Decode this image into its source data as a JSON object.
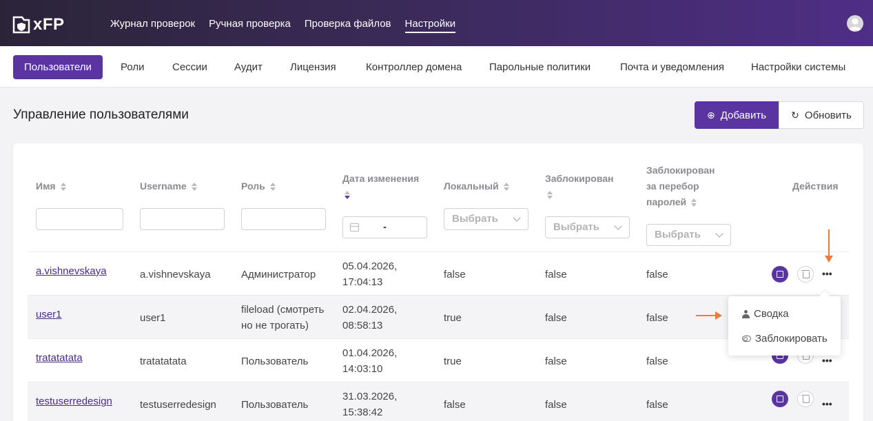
{
  "app": {
    "logo_text": "xFP"
  },
  "topnav": [
    {
      "label": "Журнал проверок"
    },
    {
      "label": "Ручная проверка"
    },
    {
      "label": "Проверка файлов"
    },
    {
      "label": "Настройки"
    }
  ],
  "subnav": [
    {
      "label": "Пользователи"
    },
    {
      "label": "Роли"
    },
    {
      "label": "Сессии"
    },
    {
      "label": "Аудит"
    },
    {
      "label": "Лицензия"
    },
    {
      "label": "Контроллер домена"
    },
    {
      "label": "Парольные политики"
    },
    {
      "label": "Почта и уведомления"
    },
    {
      "label": "Настройки системы"
    }
  ],
  "page": {
    "title": "Управление пользователями",
    "add_label": "Добавить",
    "refresh_label": "Обновить"
  },
  "table": {
    "headers": {
      "name": "Имя",
      "username": "Username",
      "role": "Роль",
      "modified": "Дата изменения",
      "local": "Локальный",
      "blocked": "Заблокирован",
      "blocked_pw_1": "Заблокирован",
      "blocked_pw_2": "за перебор",
      "blocked_pw_3": "паролей",
      "actions": "Действия"
    },
    "filters": {
      "select_placeholder": "Выбрать",
      "date_separator": "-"
    },
    "rows": [
      {
        "name": "a.vishnevskaya",
        "username": "a.vishnevskaya",
        "role_1": "Администратор",
        "role_2": "",
        "date": "05.04.2026,",
        "time": "17:04:13",
        "local": "false",
        "blocked": "false",
        "blocked_pw": "false"
      },
      {
        "name": "user1",
        "username": "user1",
        "role_1": "fileload (смотреть",
        "role_2": "но не трогать)",
        "date": "02.04.2026,",
        "time": "08:58:13",
        "local": "true",
        "blocked": "false",
        "blocked_pw": "false"
      },
      {
        "name": "tratatatata",
        "username": "tratatatata",
        "role_1": "Пользователь",
        "role_2": "",
        "date": "01.04.2026,",
        "time": "14:03:10",
        "local": "true",
        "blocked": "false",
        "blocked_pw": "false"
      },
      {
        "name": "testuserredesign",
        "username": "testuserredesign",
        "role_1": "Пользователь",
        "role_2": "",
        "date": "31.03.2026,",
        "time": "15:38:42",
        "local": "false",
        "blocked": "false",
        "blocked_pw": "false"
      }
    ]
  },
  "row_menu": {
    "summary": "Сводка",
    "block": "Заблокировать"
  },
  "colors": {
    "accent": "#5a34a1",
    "annotation_arrow": "#f07a3a"
  }
}
